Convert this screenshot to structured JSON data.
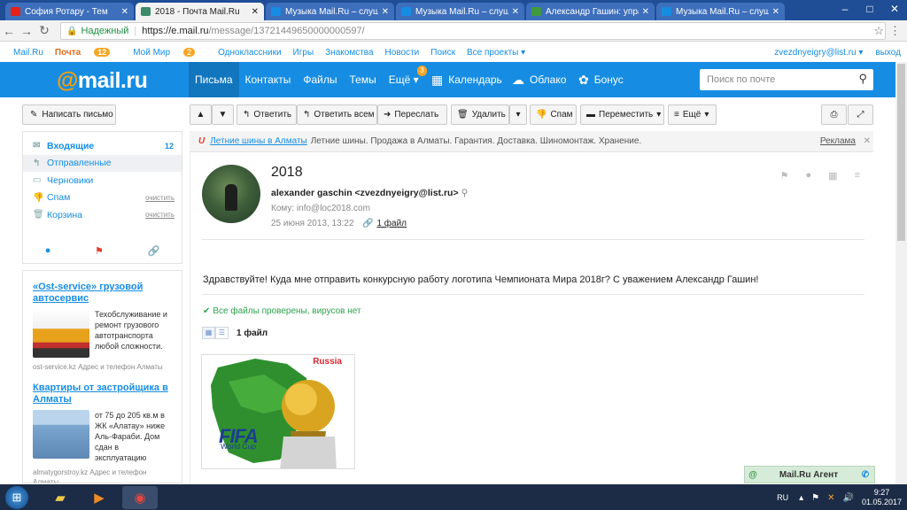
{
  "browser": {
    "tabs": [
      {
        "title": "София Ротару - Тем",
        "icon_color": "#e62117"
      },
      {
        "title": "2018 - Почта Mail.Ru",
        "icon_color": "#3d8b6a"
      },
      {
        "title": "Музыка Mail.Ru – слуша",
        "icon_color": "#168de2"
      },
      {
        "title": "Музыка Mail.Ru – слуша",
        "icon_color": "#168de2"
      },
      {
        "title": "Александр Гашин: упра",
        "icon_color": "#3f9b3e"
      },
      {
        "title": "Музыка Mail.Ru – слуша",
        "icon_color": "#168de2"
      }
    ],
    "secure_label": "Надежный",
    "url_host": "https://e.mail.ru",
    "url_path": "/message/13721449650000000597/"
  },
  "portal": {
    "links": [
      "Mail.Ru",
      "Почта",
      "Мой Мир",
      "Одноклассники",
      "Игры",
      "Знакомства",
      "Новости",
      "Поиск",
      "Все проекты ▾"
    ],
    "mail_badge": "12",
    "mir_badge": "2",
    "user": "zvezdnyeigry@list.ru ▾",
    "logout": "выход"
  },
  "header": {
    "logo_at": "@",
    "logo_text": "mail.ru",
    "nav": [
      "Письма",
      "Контакты",
      "Файлы",
      "Темы",
      "Ещё"
    ],
    "more_badge": "3",
    "calendar": "Календарь",
    "cloud": "Облако",
    "bonus": "Бонус",
    "search_placeholder": "Поиск по почте"
  },
  "toolbar": {
    "compose": "Написать письмо",
    "reply": "Ответить",
    "reply_all": "Ответить всем",
    "forward": "Переслать",
    "delete": "Удалить",
    "spam": "Спам",
    "move": "Переместить",
    "more": "Ещё"
  },
  "folders": [
    {
      "name": "Входящие",
      "count": "12"
    },
    {
      "name": "Отправленные"
    },
    {
      "name": "Черновики"
    },
    {
      "name": "Спам",
      "action": "очистить"
    },
    {
      "name": "Корзина",
      "action": "очистить"
    }
  ],
  "ads": [
    {
      "title": "«Ost-service» грузовой автосервис",
      "text": "Техобслуживание и ремонт грузового автотранспорта любой сложности.",
      "source": "ost-service.kz   Адрес и телефон Алматы"
    },
    {
      "title": "Квартиры от застройщика в Алматы",
      "text": "от 75 до 205 кв.м в ЖК «Алатау» ниже Аль-Фараби. Дом сдан в эксплуатацию",
      "source": "almatygorstroy.kz   Адрес и телефон Алматы"
    }
  ],
  "banner": {
    "link": "Летние шины в Алматы",
    "text": "Летние шины. Продажа в Алматы. Гарантия. Доставка. Шиномонтаж. Хранение.",
    "ad_label": "Реклама"
  },
  "message": {
    "subject": "2018",
    "from": "alexander gaschin <zvezdnyeigry@list.ru>",
    "to": "Кому: info@loc2018.com",
    "date": "25 июня 2013, 13:22",
    "attach": "1 файл",
    "body": "Здравствуйте! Куда мне отправить конкурсную работу логотипа Чемпионата Мира 2018г? С уважением Александр Гашин!",
    "virus_ok": "Все файлы проверены, вирусов нет",
    "files_count": "1 файл",
    "thumb": {
      "russia": "Russia",
      "fifa": "FIFA",
      "world_cup": "World Cup"
    }
  },
  "agent": {
    "label": "Mail.Ru Агент"
  },
  "taskbar": {
    "lang": "RU",
    "time": "9:27",
    "date": "01.05.2017"
  },
  "colors": {
    "brand": "#168de2",
    "accent": "#f6a623"
  }
}
